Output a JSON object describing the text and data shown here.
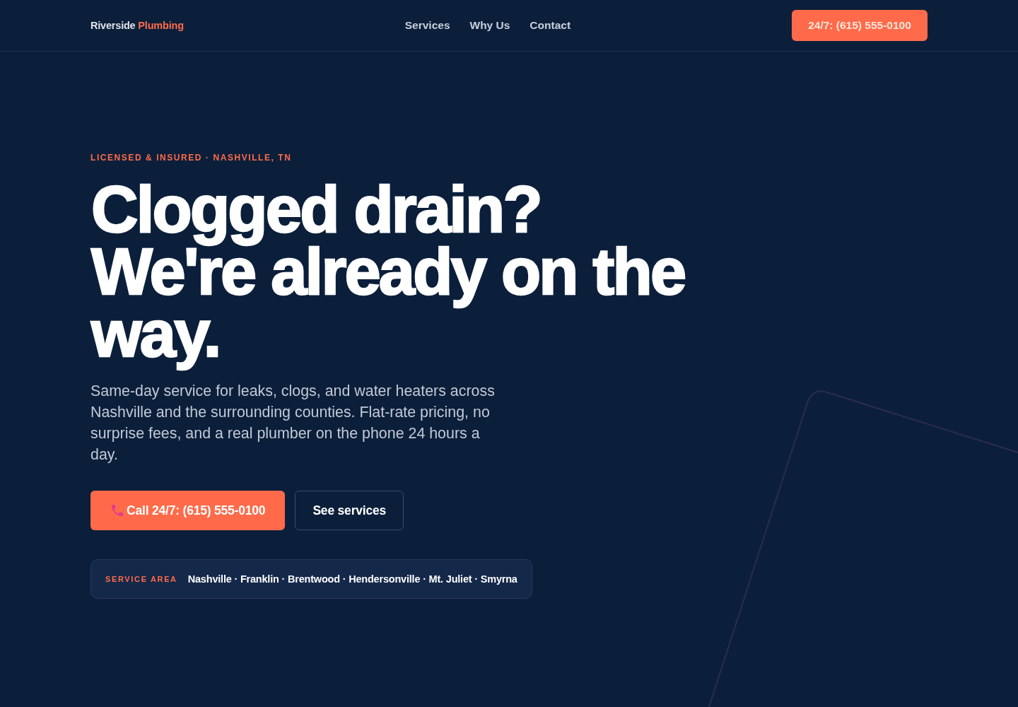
{
  "nav": {
    "logo": {
      "name": "Riverside",
      "accent": "Plumbing"
    },
    "links": [
      "Services",
      "Why Us",
      "Contact"
    ],
    "cta": "24/7: (615) 555-0100"
  },
  "hero": {
    "eyebrow": "LICENSED & INSURED · NASHVILLE, TN",
    "headline": "Clogged drain? We're already on the way.",
    "description": "Same-day service for leaks, clogs, and water heaters across Nashville and the surrounding counties. Flat-rate pricing, no surprise fees, and a real plumber on the phone 24 hours a day.",
    "buttons": [
      {
        "kind": "primary",
        "label": "Call 24/7: (615) 555-0100"
      },
      {
        "kind": "secondary",
        "label": "See services"
      }
    ],
    "service_area": {
      "label": "SERVICE AREA",
      "towns": "Nashville · Franklin · Brentwood · Hendersonville · Mt. Juliet · Smyrna"
    }
  }
}
